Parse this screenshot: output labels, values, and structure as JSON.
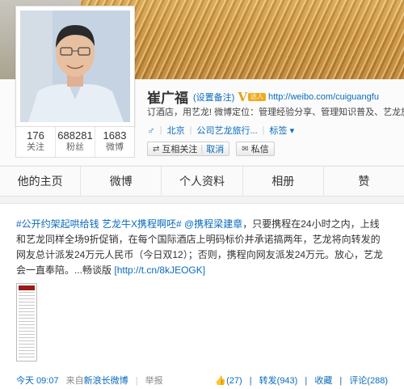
{
  "profile": {
    "name": "崔广福",
    "remark_link": "(设置备注)",
    "verified_mark": "V",
    "vip_badge": "达人",
    "weibo_url": "http://weibo.com/cuiguangfu",
    "description": "订酒店，用艺龙! 微博定位：管理经验分享、管理知识普及、艺龙旅行网资讯",
    "gender_icon": "male-icon",
    "location": "北京",
    "company": "公司艺龙旅行...",
    "tags_label": "标签",
    "follow_button": "互相关注",
    "cancel_follow": "取消",
    "message_button": "私信",
    "stats": [
      {
        "num": "176",
        "label": "关注"
      },
      {
        "num": "688281",
        "label": "粉丝"
      },
      {
        "num": "1683",
        "label": "微博"
      }
    ]
  },
  "tabs": [
    "他的主页",
    "微博",
    "个人资料",
    "相册",
    "赞"
  ],
  "post": {
    "hashtag1": "#公开约架起哄给钱 艺龙牛X携程啊呸#",
    "mention": "@携程梁建章",
    "text1": "，只要携程在24小时之内，上线和艺龙同样全场9折促销，在每个国际酒店上明码标价并承诺搞两年，艺龙将向转发的网友总计派发24万元人民币（今日双12）；否则，携程向网友派发24万元。放心，艺龙会一直奉陪。...畅谈版",
    "short_link": "http://t.cn/8kJEOGK",
    "time": "今天 09:07",
    "source_prefix": "来自",
    "source": "新浪长微博",
    "report": "举报",
    "likes": "(27)",
    "repost": "转发(943)",
    "favorite": "收藏",
    "comment": "评论(288)"
  },
  "colors": {
    "link": "#0a6bbd",
    "v_badge": "#e7a117"
  }
}
